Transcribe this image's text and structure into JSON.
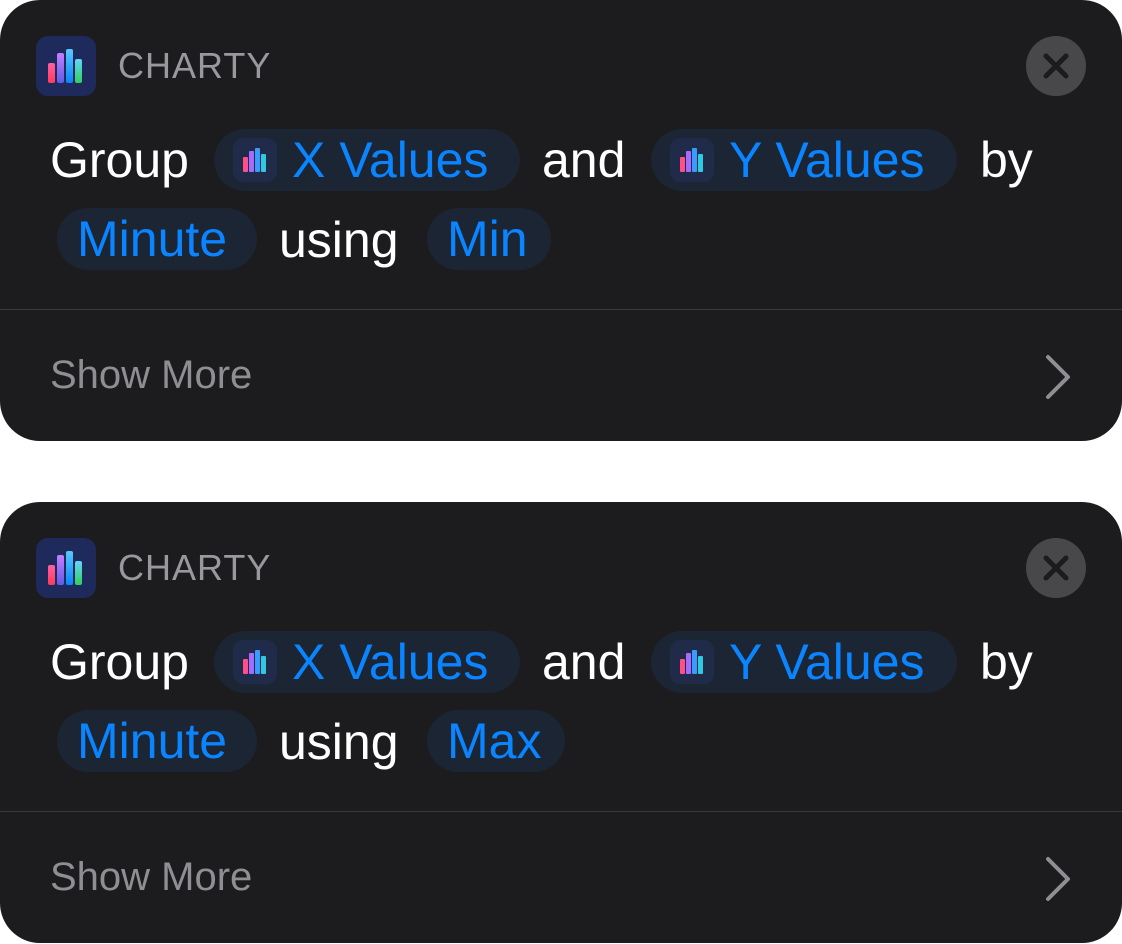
{
  "colors": {
    "card_background": "#1c1c1e",
    "token_background": "#1b2533",
    "token_text": "#0a84ff",
    "secondary_text": "#8e8e93"
  },
  "actions": [
    {
      "app_name": "CHARTY",
      "app_icon": "bar-chart-icon",
      "close_icon": "close-icon",
      "parts": {
        "word_group": "Group",
        "x_values": "X Values",
        "word_and": "and",
        "y_values": "Y Values",
        "word_by": "by",
        "unit": "Minute",
        "word_using": "using",
        "method": "Min"
      },
      "show_more": "Show More",
      "chevron_icon": "chevron-right-icon"
    },
    {
      "app_name": "CHARTY",
      "app_icon": "bar-chart-icon",
      "close_icon": "close-icon",
      "parts": {
        "word_group": "Group",
        "x_values": "X Values",
        "word_and": "and",
        "y_values": "Y Values",
        "word_by": "by",
        "unit": "Minute",
        "word_using": "using",
        "method": "Max"
      },
      "show_more": "Show More",
      "chevron_icon": "chevron-right-icon"
    }
  ]
}
